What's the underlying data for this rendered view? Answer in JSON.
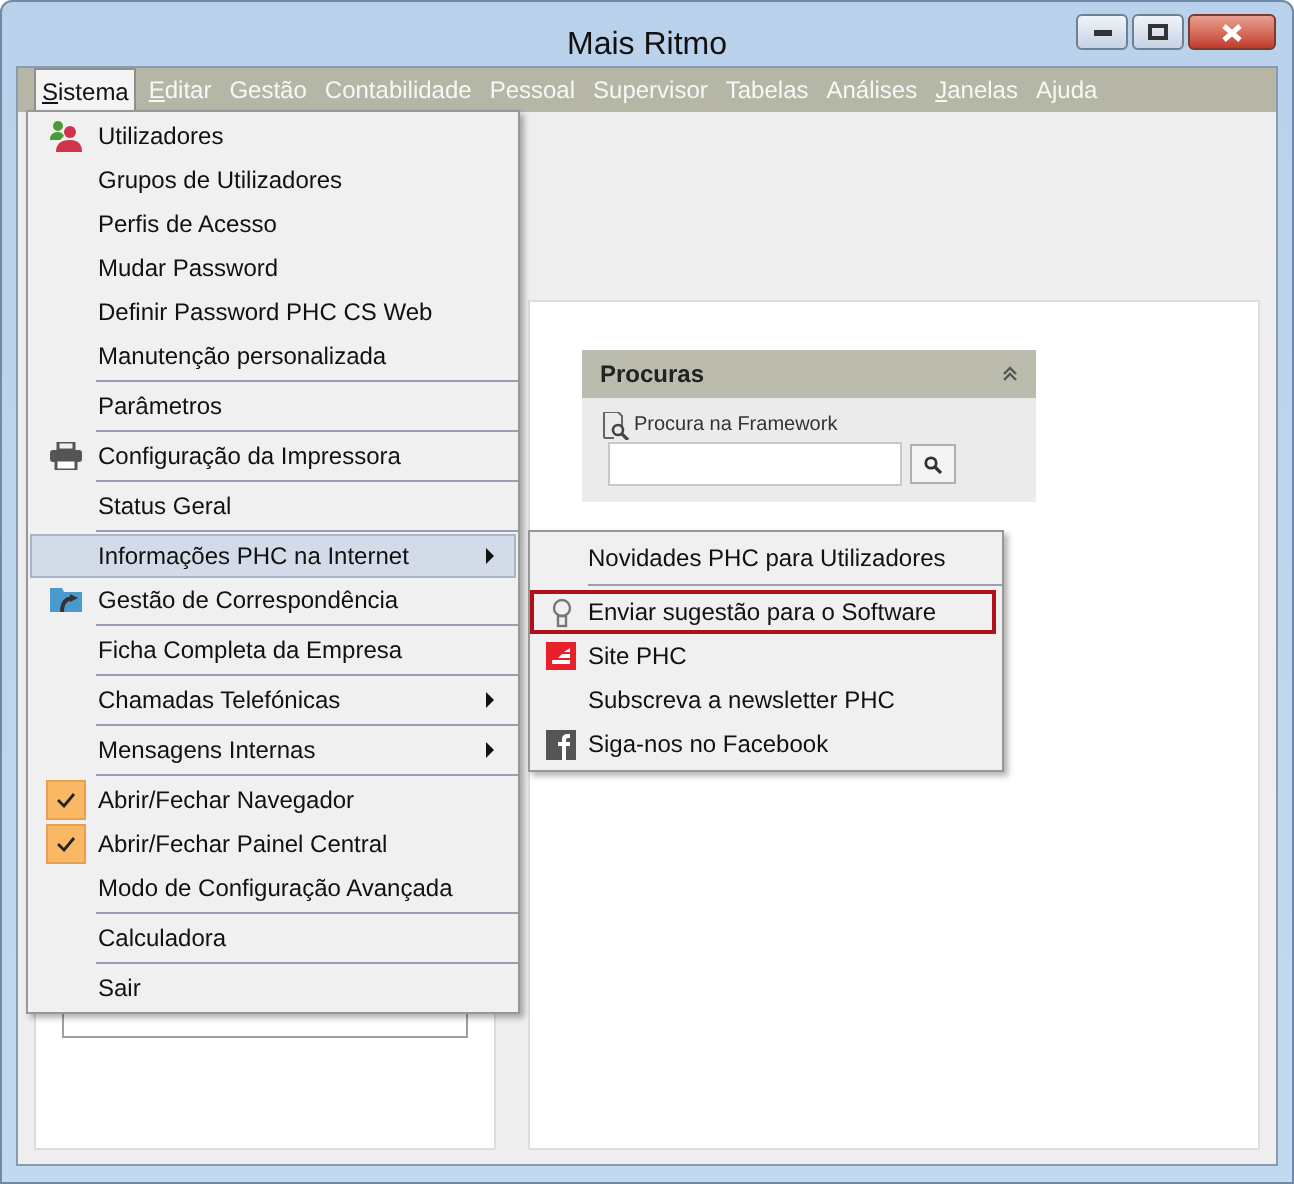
{
  "window": {
    "title": "Mais Ritmo"
  },
  "menubar": [
    {
      "label": "Sistema",
      "selected": true,
      "mnemonic": true
    },
    {
      "label": "Editar",
      "selected": false,
      "mnemonic": true
    },
    {
      "label": "Gestão",
      "selected": false,
      "mnemonic": false
    },
    {
      "label": "Contabilidade",
      "selected": false,
      "mnemonic": false
    },
    {
      "label": "Pessoal",
      "selected": false,
      "mnemonic": false
    },
    {
      "label": "Supervisor",
      "selected": false,
      "mnemonic": false
    },
    {
      "label": "Tabelas",
      "selected": false,
      "mnemonic": false
    },
    {
      "label": "Análises",
      "selected": false,
      "mnemonic": false
    },
    {
      "label": "Janelas",
      "selected": false,
      "mnemonic": true
    },
    {
      "label": "Ajuda",
      "selected": false,
      "mnemonic": false
    }
  ],
  "menu": {
    "groups": [
      [
        {
          "label": "Utilizadores",
          "kind": "users",
          "checked": false,
          "submenu": false,
          "selected": false
        },
        {
          "label": "Grupos de Utilizadores",
          "kind": "plain",
          "checked": false,
          "submenu": false,
          "selected": false
        },
        {
          "label": "Perfis de Acesso",
          "kind": "plain",
          "checked": false,
          "submenu": false,
          "selected": false
        },
        {
          "label": "Mudar Password",
          "kind": "plain",
          "checked": false,
          "submenu": false,
          "selected": false
        },
        {
          "label": "Definir Password PHC CS Web",
          "kind": "plain",
          "checked": false,
          "submenu": false,
          "selected": false
        },
        {
          "label": "Manutenção personalizada",
          "kind": "plain",
          "checked": false,
          "submenu": false,
          "selected": false
        }
      ],
      [
        {
          "label": "Parâmetros",
          "kind": "plain",
          "checked": false,
          "submenu": false,
          "selected": false
        }
      ],
      [
        {
          "label": "Configuração da Impressora",
          "kind": "printer",
          "checked": false,
          "submenu": false,
          "selected": false
        }
      ],
      [
        {
          "label": "Status Geral",
          "kind": "plain",
          "checked": false,
          "submenu": false,
          "selected": false
        }
      ],
      [
        {
          "label": "Informações PHC na Internet",
          "kind": "plain",
          "checked": false,
          "submenu": true,
          "selected": true
        },
        {
          "label": "Gestão de Correspondência",
          "kind": "folder",
          "checked": false,
          "submenu": false,
          "selected": false
        }
      ],
      [
        {
          "label": "Ficha Completa da Empresa",
          "kind": "plain",
          "checked": false,
          "submenu": false,
          "selected": false
        }
      ],
      [
        {
          "label": "Chamadas Telefónicas",
          "kind": "plain",
          "checked": false,
          "submenu": true,
          "selected": false
        }
      ],
      [
        {
          "label": "Mensagens Internas",
          "kind": "plain",
          "checked": false,
          "submenu": true,
          "selected": false
        }
      ],
      [
        {
          "label": "Abrir/Fechar Navegador",
          "kind": "plain",
          "checked": true,
          "submenu": false,
          "selected": false
        },
        {
          "label": "Abrir/Fechar Painel Central",
          "kind": "plain",
          "checked": true,
          "submenu": false,
          "selected": false
        },
        {
          "label": "Modo de Configuração Avançada",
          "kind": "plain",
          "checked": false,
          "submenu": false,
          "selected": false
        }
      ],
      [
        {
          "label": "Calculadora",
          "kind": "plain",
          "checked": false,
          "submenu": false,
          "selected": false
        }
      ],
      [
        {
          "label": "Sair",
          "kind": "plain",
          "checked": false,
          "submenu": false,
          "selected": false
        }
      ]
    ]
  },
  "submenu": {
    "groups": [
      [
        {
          "label": "Novidades PHC para Utilizadores",
          "kind": "plain",
          "selected": false
        }
      ],
      [
        {
          "label": "Enviar sugestão para o Software",
          "kind": "bulb",
          "selected": true
        },
        {
          "label": "Site PHC",
          "kind": "logo",
          "selected": false
        },
        {
          "label": "Subscreva a newsletter PHC",
          "kind": "plain",
          "selected": false
        },
        {
          "label": "Siga-nos no Facebook",
          "kind": "facebook",
          "selected": false
        }
      ]
    ]
  },
  "search_panel": {
    "title": "Procuras",
    "label": "Procura na Framework"
  }
}
